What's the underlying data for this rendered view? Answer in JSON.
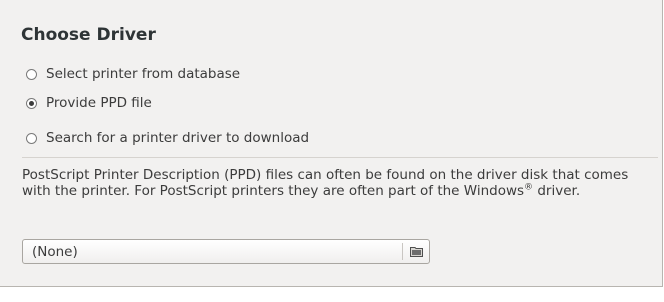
{
  "dialog": {
    "title": "Choose Driver",
    "options": [
      {
        "label": "Select printer from database",
        "selected": false
      },
      {
        "label": "Provide PPD file",
        "selected": true
      },
      {
        "label": "Search for a printer driver to download",
        "selected": false
      }
    ],
    "description": {
      "text": "PostScript Printer Description (PPD) files can often be found on the driver disk that comes with the printer. For PostScript printers they are often part of the Windows",
      "registered_mark": "®",
      "text_suffix": " driver."
    },
    "file_chooser": {
      "value": "(None)",
      "icon": "folder-icon"
    }
  },
  "colors": {
    "panel_background": "#f2f1f0",
    "text": "#3c3c3c",
    "title_text": "#2e3436"
  }
}
